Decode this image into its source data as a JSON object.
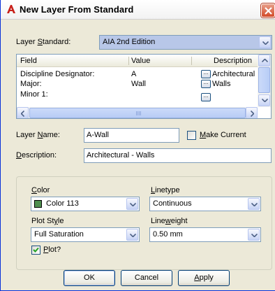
{
  "window": {
    "title": "New Layer From Standard"
  },
  "colors": {
    "accent": "#0831d9",
    "close": "#d34a28",
    "swatch_color_113": "#4f8f4f"
  },
  "layer_standard": {
    "label_pre": "Layer ",
    "label_key": "S",
    "label_post": "tandard:",
    "value": "AIA 2nd Edition"
  },
  "table": {
    "columns": [
      "Field",
      "Value",
      "Description"
    ],
    "rows": [
      {
        "field": "Discipline Designator:",
        "value": "A",
        "description": "Architectural"
      },
      {
        "field": "Major:",
        "value": "Wall",
        "description": "Walls"
      },
      {
        "field": "Minor 1:",
        "value": "",
        "description": ""
      }
    ]
  },
  "layer_name": {
    "label_pre": "Layer ",
    "label_key": "N",
    "label_post": "ame:",
    "value": "A-Wall"
  },
  "make_current": {
    "label_key": "M",
    "label_post": "ake Current",
    "checked": false
  },
  "description": {
    "label_key": "D",
    "label_post": "escription:",
    "value": "Architectural - Walls"
  },
  "properties": {
    "color": {
      "label_key": "C",
      "label_post": "olor",
      "value": "Color 113"
    },
    "linetype": {
      "label_key": "L",
      "label_post": "inetype",
      "value": "Continuous"
    },
    "plot_style": {
      "label_pre": "Plot St",
      "label_key": "y",
      "label_post": "le",
      "value": "Full Saturation"
    },
    "lineweight": {
      "label_pre": "Line",
      "label_key": "w",
      "label_post": "eight",
      "value": "0.50 mm"
    },
    "plot": {
      "label_key": "P",
      "label_post": "lot?",
      "checked": true
    }
  },
  "buttons": {
    "ok": "OK",
    "cancel": "Cancel",
    "apply_key": "A",
    "apply_post": "pply"
  }
}
